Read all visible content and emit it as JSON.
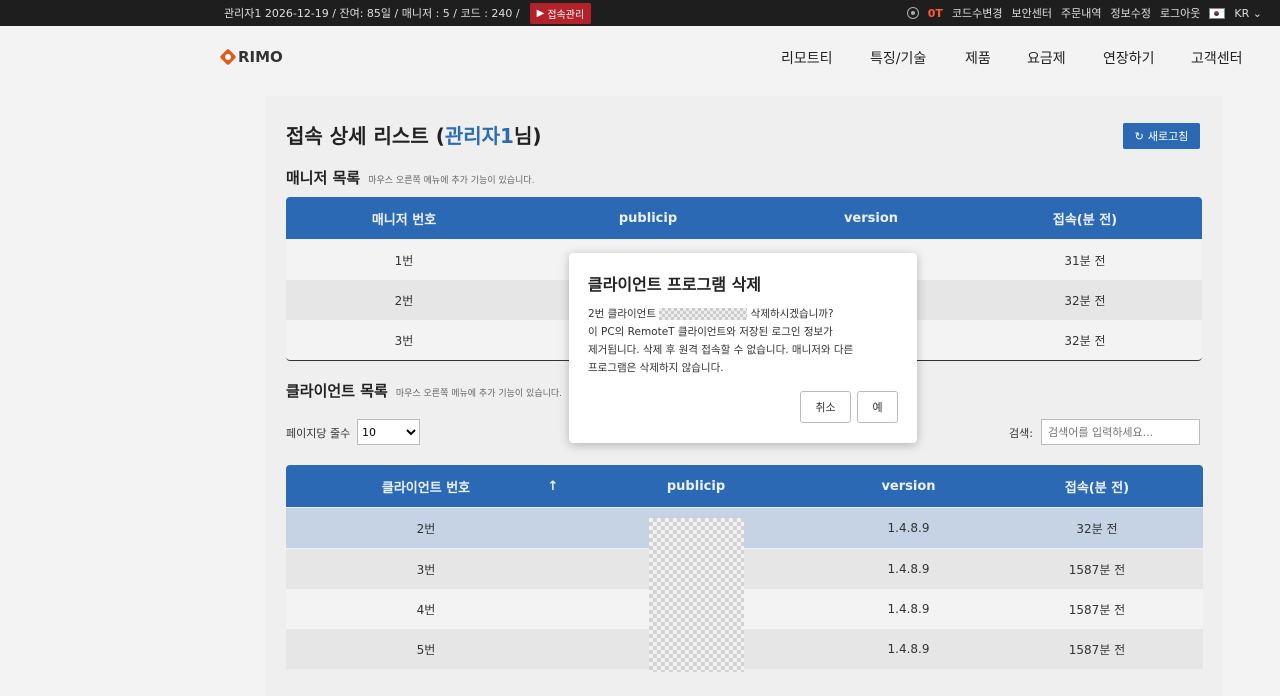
{
  "topbar": {
    "info": "관리자1   2026-12-19 / 잔여: 85일 / 매니저 : 5 / 코드 : 240 /",
    "access_btn": "접속관리",
    "tokens": "0T",
    "links": [
      "코드수변경",
      "보안센터",
      "주문내역",
      "정보수정",
      "로그아웃"
    ],
    "lang": "KR"
  },
  "header": {
    "logo": "RIMO",
    "nav": [
      "리모트티",
      "특징/기술",
      "제품",
      "요금제",
      "연장하기",
      "고객센터"
    ]
  },
  "page": {
    "title_prefix": "접속 상세 리스트 (",
    "title_admin": "관리자1",
    "title_suffix": "님)",
    "refresh": "새로고침"
  },
  "managers": {
    "title": "매니저 목록",
    "hint": "마우스 오른쪽 메뉴에 추가 기능이 있습니다.",
    "columns": [
      "매니저 번호",
      "publicip",
      "version",
      "접속(분 전)"
    ],
    "rows": [
      {
        "no": "1번",
        "ago": "31분 전"
      },
      {
        "no": "2번",
        "ago": "32분 전"
      },
      {
        "no": "3번",
        "ago": "32분 전"
      }
    ]
  },
  "clients": {
    "title": "클라이언트 목록",
    "hint": "마우스 오른쪽 메뉴에 추가 기능이 있습니다.",
    "page_size_label": "페이지당 줄수",
    "page_size": "10",
    "search_label": "검색:",
    "search_placeholder": "검색어를 입력하세요...",
    "columns": [
      "클라이언트 번호",
      "publicip",
      "version",
      "접속(분 전)"
    ],
    "sort_arrow": "↑",
    "rows": [
      {
        "no": "2번",
        "version": "1.4.8.9",
        "ago": "32분 전"
      },
      {
        "no": "3번",
        "version": "1.4.8.9",
        "ago": "1587분 전"
      },
      {
        "no": "4번",
        "version": "1.4.8.9",
        "ago": "1587분 전"
      },
      {
        "no": "5번",
        "version": "1.4.8.9",
        "ago": "1587분 전"
      }
    ]
  },
  "modal": {
    "title": "클라이언트 프로그램 삭제",
    "line1_prefix": "2번 클라이언트",
    "line1_suffix": "삭제하시겠습니까?",
    "line2": "이 PC의 RemoteT 클라이언트와 저장된 로그인 정보가",
    "line3": "제거됩니다. 삭제 후 원격 접속할 수 없습니다. 매니저와 다른",
    "line4": "프로그램은 삭제하지 않습니다.",
    "cancel": "취소",
    "confirm": "예"
  },
  "colors": {
    "accent": "#2c69b5",
    "danger": "#b3222a",
    "token": "#ff5b2e"
  }
}
